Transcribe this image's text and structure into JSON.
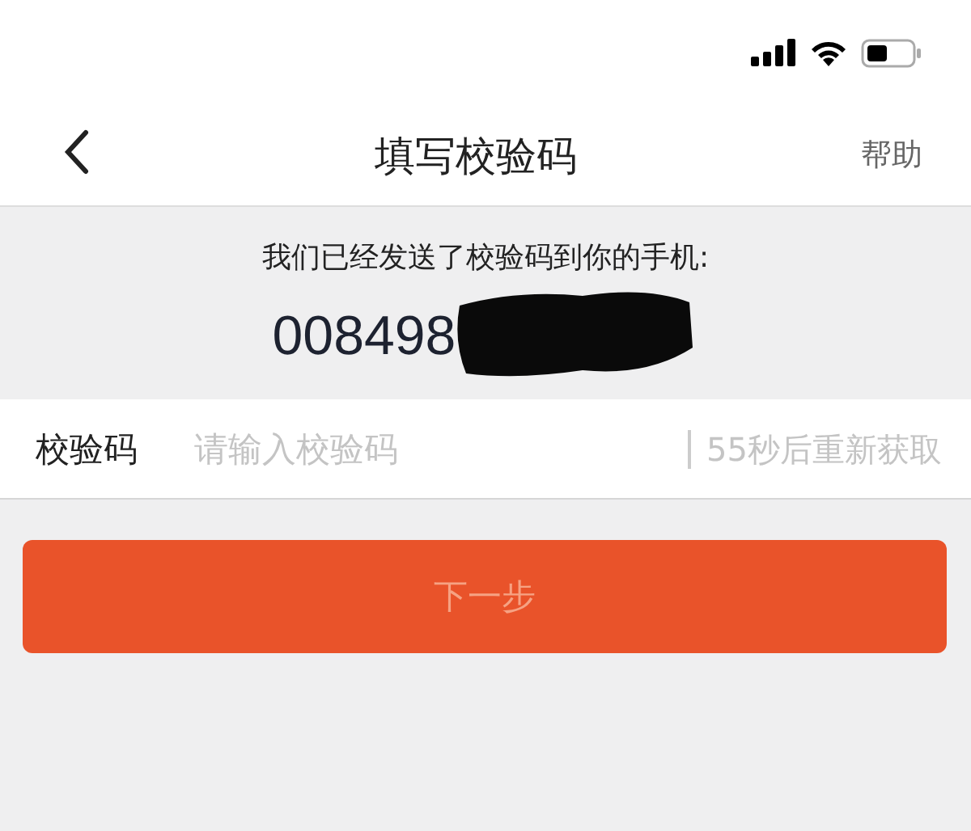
{
  "nav": {
    "title": "填写校验码",
    "help": "帮助"
  },
  "notice": {
    "message": "我们已经发送了校验码到你的手机:",
    "phone": "008498",
    "redacted": true
  },
  "code_field": {
    "label": "校验码",
    "placeholder": "请输入校验码",
    "resend": "55秒后重新获取",
    "resend_disabled": true
  },
  "next_button": {
    "label": "下一步",
    "disabled": true
  }
}
